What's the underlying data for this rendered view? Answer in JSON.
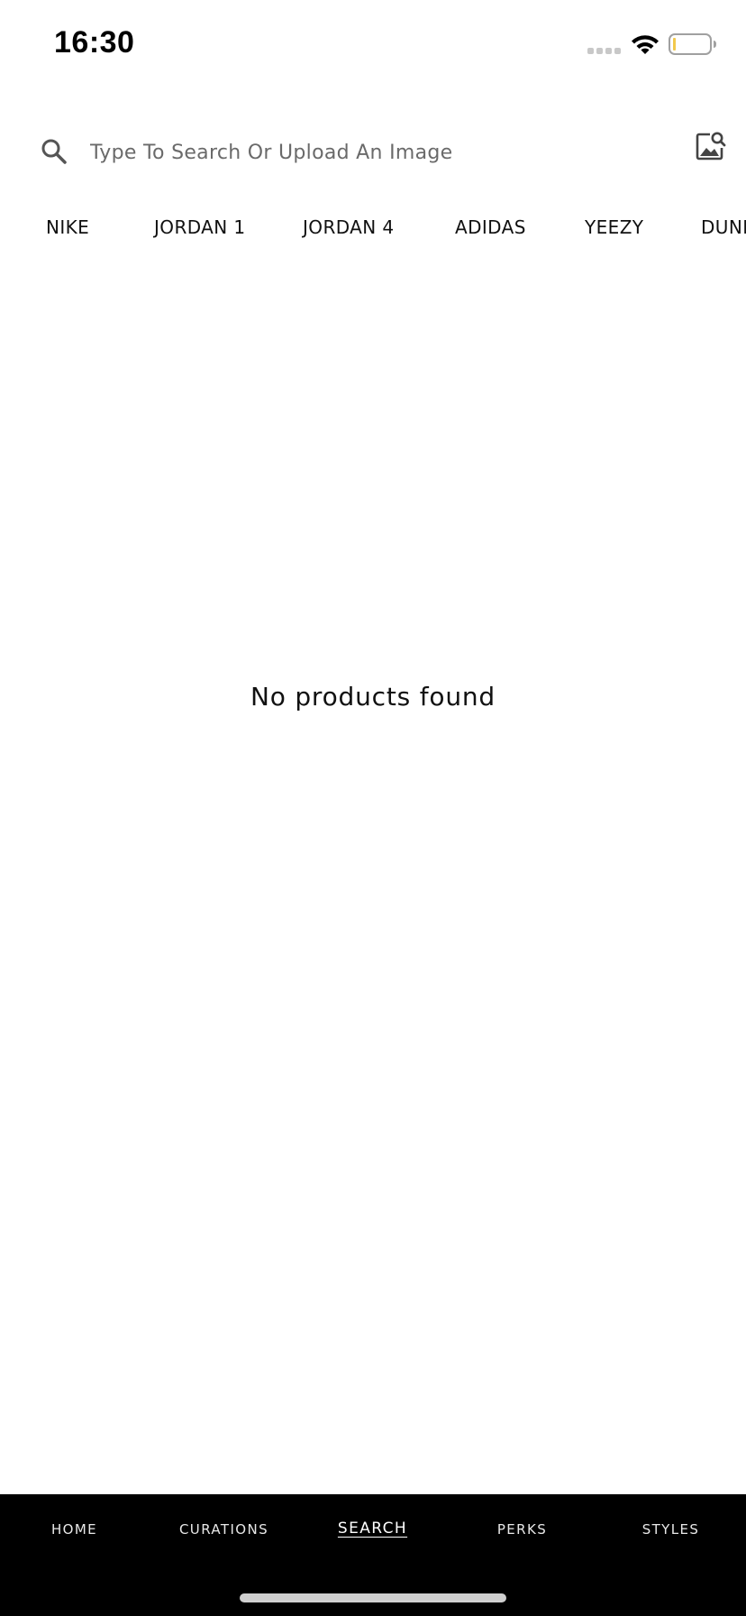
{
  "status_bar": {
    "time": "16:30"
  },
  "search": {
    "placeholder": "Type To Search Or Upload An Image",
    "value": ""
  },
  "brands": [
    "NIKE",
    "JORDAN 1",
    "JORDAN 4",
    "ADIDAS",
    "YEEZY",
    "DUNK"
  ],
  "empty_state": {
    "message": "No products found"
  },
  "tabs": [
    {
      "label": "HOME"
    },
    {
      "label": "CURATIONS"
    },
    {
      "label": "SEARCH",
      "active": true
    },
    {
      "label": "PERKS"
    },
    {
      "label": "STYLES"
    }
  ],
  "colors": {
    "tab_bar_bg": "#000000",
    "battery_level_fill": "#f2c94c"
  }
}
